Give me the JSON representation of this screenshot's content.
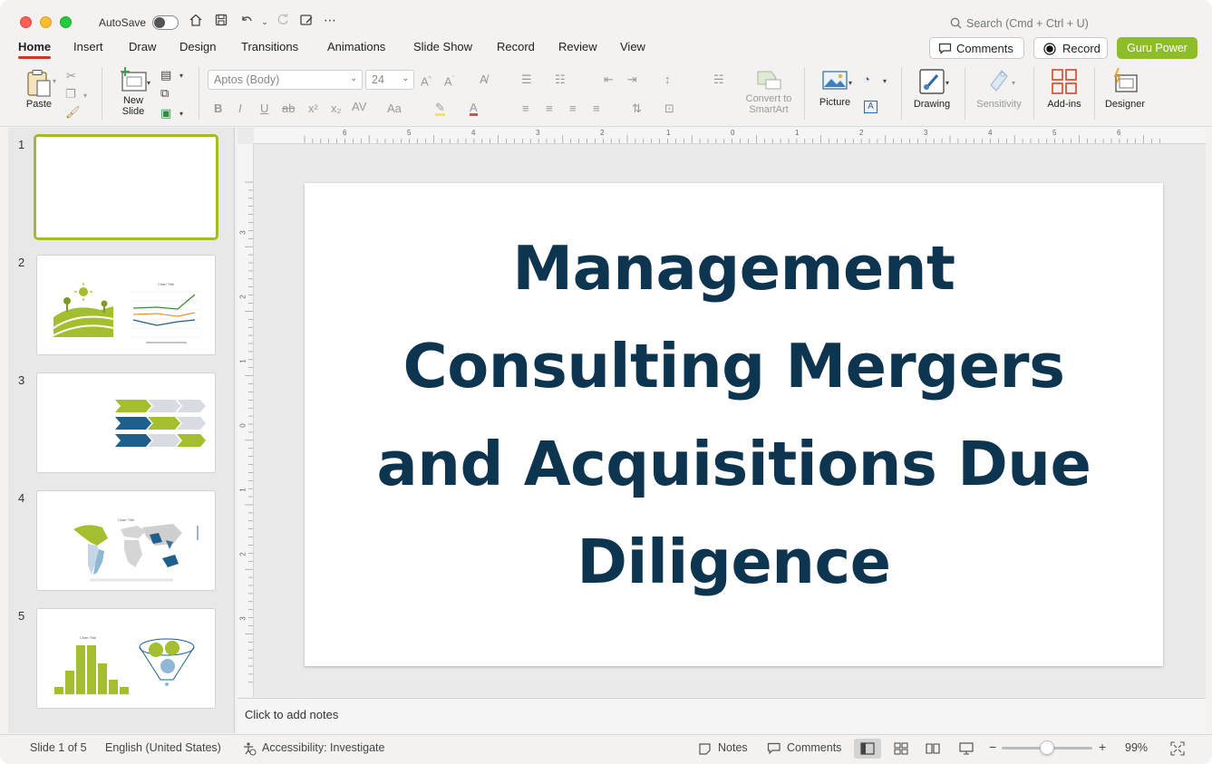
{
  "titlebar": {
    "autosave_label": "AutoSave",
    "search_placeholder": "Search (Cmd + Ctrl + U)"
  },
  "tabs": [
    {
      "label": "Home",
      "active": true
    },
    {
      "label": "Insert"
    },
    {
      "label": "Draw"
    },
    {
      "label": "Design"
    },
    {
      "label": "Transitions"
    },
    {
      "label": "Animations"
    },
    {
      "label": "Slide Show"
    },
    {
      "label": "Record"
    },
    {
      "label": "Review"
    },
    {
      "label": "View"
    }
  ],
  "header_buttons": {
    "comments": "Comments",
    "record": "Record",
    "guru": "Guru Power"
  },
  "ribbon": {
    "paste": "Paste",
    "new_slide_1": "New",
    "new_slide_2": "Slide",
    "font_name": "Aptos (Body)",
    "font_size": "24",
    "convert_1": "Convert to",
    "convert_2": "SmartArt",
    "picture": "Picture",
    "drawing": "Drawing",
    "sensitivity": "Sensitivity",
    "addins": "Add-ins",
    "designer": "Designer"
  },
  "thumbnails": [
    {
      "number": "1"
    },
    {
      "number": "2",
      "chart_title": "Chart Title"
    },
    {
      "number": "3"
    },
    {
      "number": "4",
      "chart_title": "Chart Title"
    },
    {
      "number": "5",
      "chart_title": "Chart Title"
    }
  ],
  "ruler": {
    "h": [
      "6",
      "5",
      "4",
      "3",
      "2",
      "1",
      "0",
      "1",
      "2",
      "3",
      "4",
      "5",
      "6"
    ],
    "v": [
      "3",
      "2",
      "1",
      "0",
      "1",
      "2",
      "3"
    ]
  },
  "slide": {
    "title_lines": [
      "Management",
      "Consulting Mergers",
      "and Acquisitions Due",
      "Diligence"
    ]
  },
  "notes": {
    "placeholder": "Click to add notes"
  },
  "status": {
    "slide_counter": "Slide 1 of 5",
    "language": "English (United States)",
    "accessibility": "Accessibility: Investigate",
    "notes": "Notes",
    "comments": "Comments",
    "zoom": "99%"
  },
  "colors": {
    "accent_green": "#8fbc2b",
    "title_navy": "#0d3550",
    "tab_underline": "#c43e1c",
    "selected_thumb": "#a9b82a"
  }
}
